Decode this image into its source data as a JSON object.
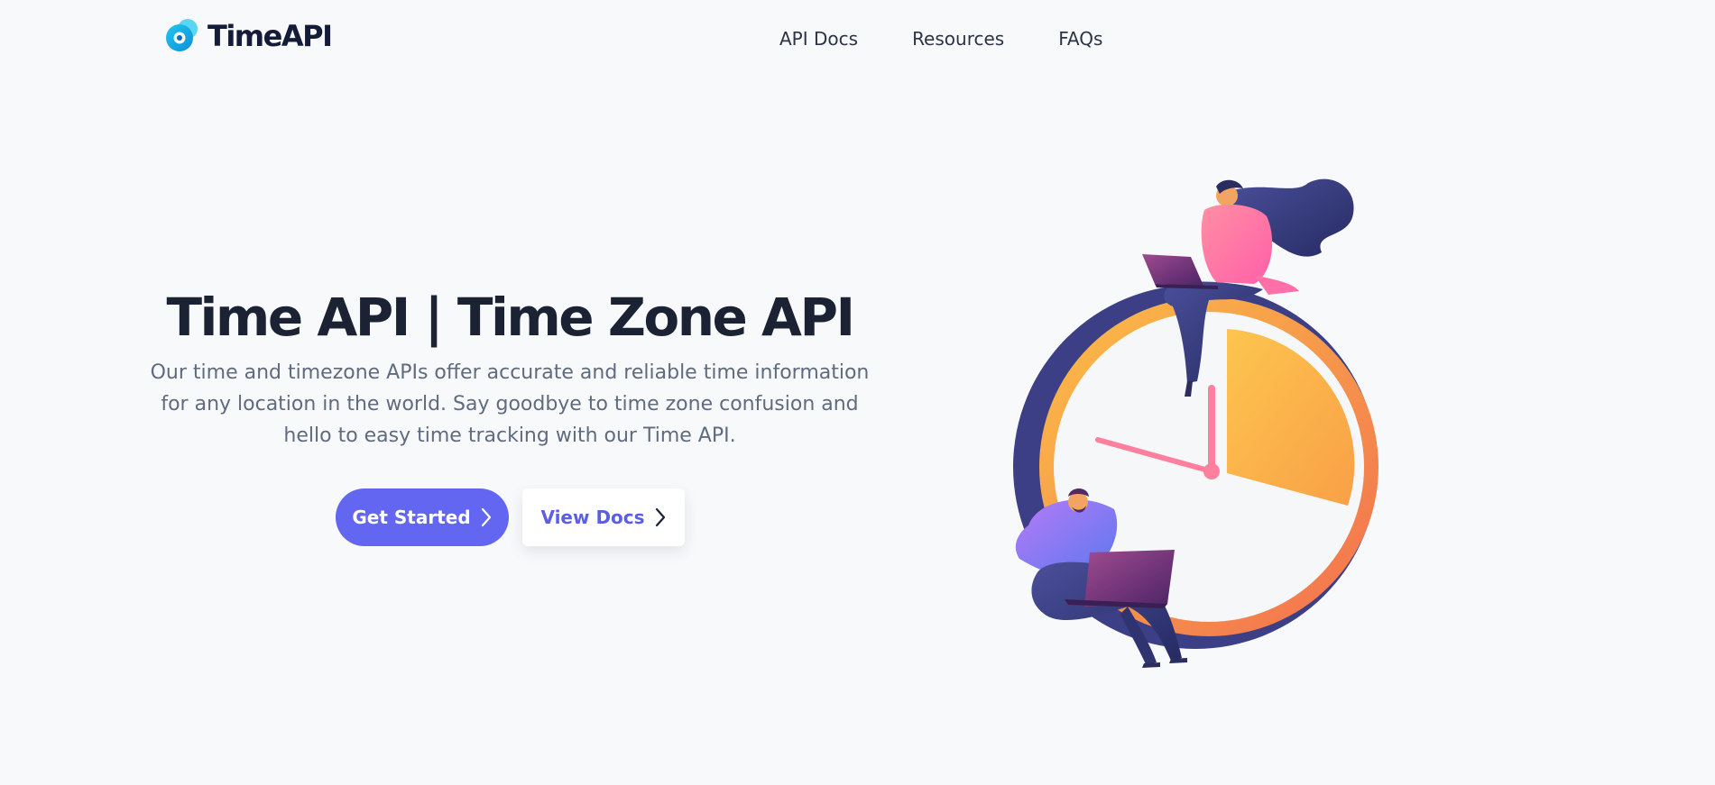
{
  "brand": {
    "name": "TimeAPI"
  },
  "nav": {
    "items": [
      {
        "label": "API Docs"
      },
      {
        "label": "Resources"
      },
      {
        "label": "FAQs"
      }
    ]
  },
  "hero": {
    "title": "Time API | Time Zone API",
    "description": "Our time and timezone APIs offer accurate and reliable time information for any location in the world. Say goodbye to time zone confusion and hello to easy time tracking with our Time API.",
    "primary_button": {
      "label": "Get Started",
      "icon": "chevron-right-icon"
    },
    "secondary_button": {
      "label": "View Docs",
      "icon": "chevron-right-icon"
    }
  },
  "colors": {
    "background": "#f8f9fb",
    "accent": "#6366f1",
    "title": "#1b2233",
    "body_text": "#5f6b7e",
    "clock_ring": "#f7a940",
    "clock_shadow": "#3c3f85"
  },
  "illustration": {
    "subject": "clock-with-people-illustration"
  }
}
